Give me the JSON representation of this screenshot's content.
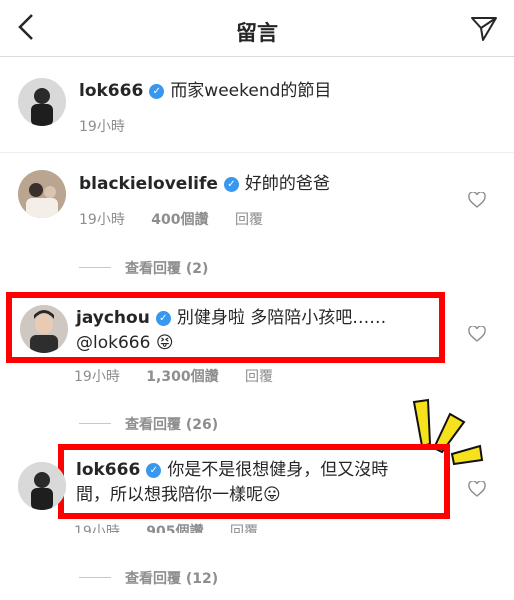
{
  "header": {
    "title": "留言",
    "back_icon": "chevron-left-icon",
    "send_icon": "direct-send-icon"
  },
  "caption": {
    "username": "lok666",
    "text": "而家weekend的節目",
    "time": "19小時"
  },
  "comments": [
    {
      "username": "blackielovelife",
      "text": "好帥的爸爸",
      "time": "19小時",
      "likes": "400個讚",
      "reply_label": "回覆",
      "view_replies": "查看回覆 (2)"
    },
    {
      "username": "jaychou",
      "text_line1": "別健身啦 多陪陪小孩吧……",
      "text_line2": "@lok666",
      "emoji": "😝",
      "time": "19小時",
      "likes": "1,300個讚",
      "reply_label": "回覆",
      "view_replies": "查看回覆 (26)"
    },
    {
      "username": "lok666",
      "text_line1": "你是不是很想健身，但又沒時",
      "text_line2": "間，所以想我陪你一樣呢",
      "emoji": "😛",
      "time": "19小時",
      "likes": "905個讚",
      "reply_label": "回覆",
      "view_replies": "查看回覆 (12)"
    }
  ],
  "colors": {
    "highlight": "#ff0000",
    "verified": "#3897f0",
    "burst": "#f5e11c"
  }
}
